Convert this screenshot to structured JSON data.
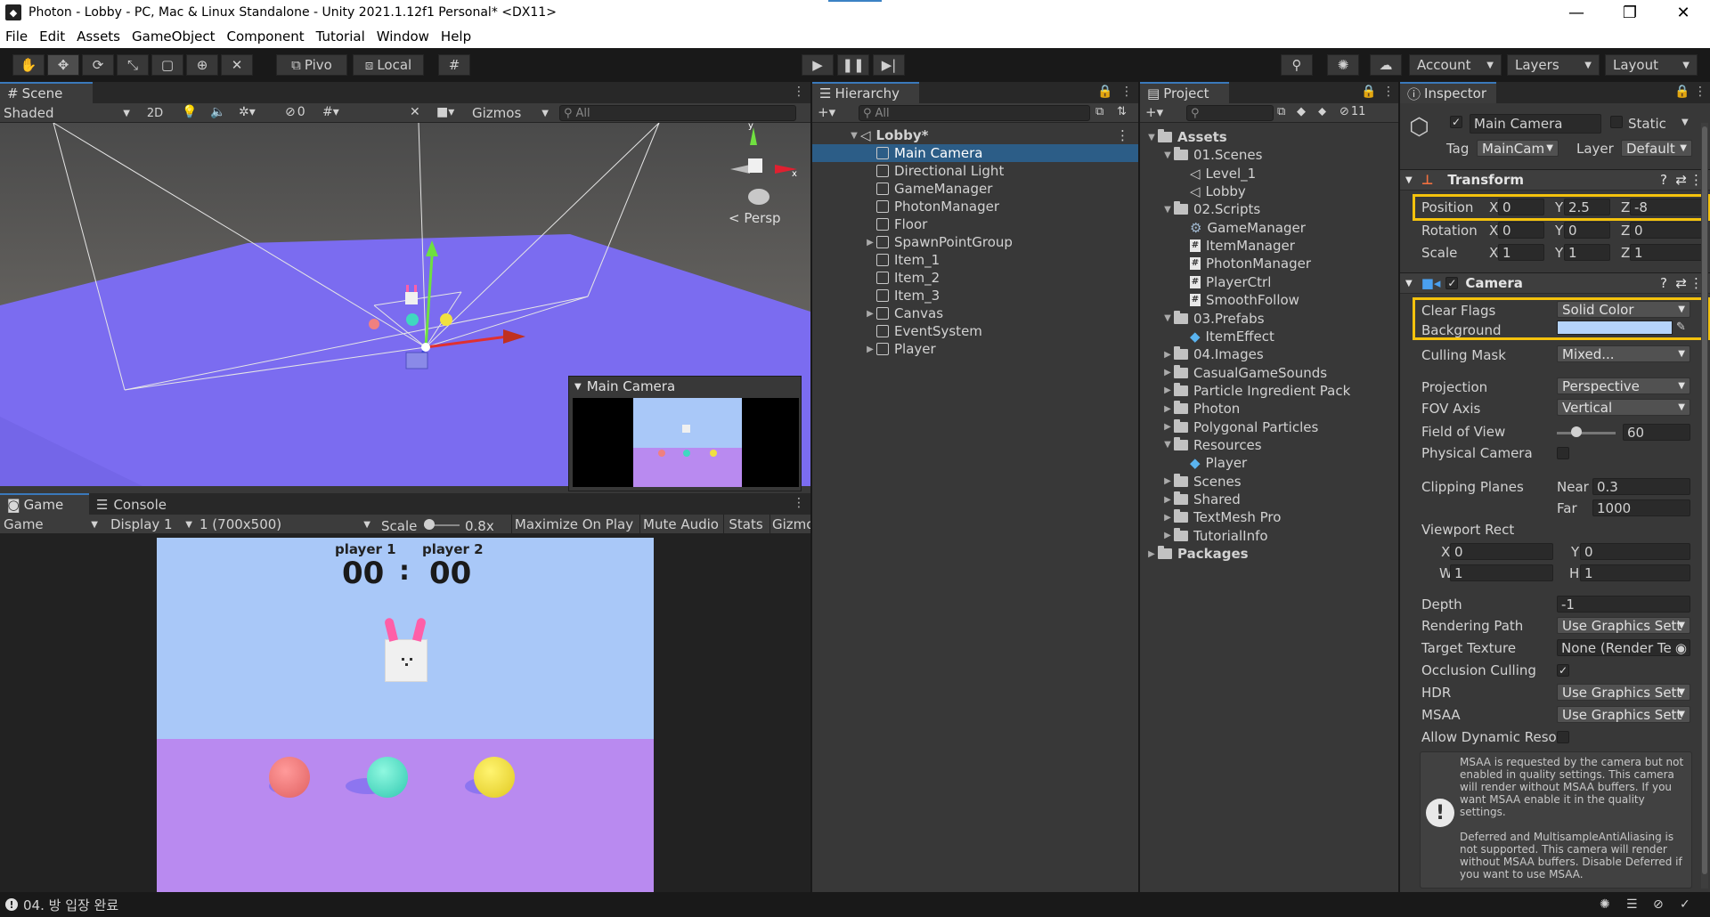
{
  "window": {
    "title": "Photon - Lobby - PC, Mac & Linux Standalone - Unity 2021.1.12f1 Personal* <DX11>",
    "minimize": "—",
    "maximize": "❐",
    "close": "✕"
  },
  "menu": [
    "File",
    "Edit",
    "Assets",
    "GameObject",
    "Component",
    "Tutorial",
    "Window",
    "Help"
  ],
  "toolbar": {
    "pivot": "Pivo",
    "local": "Local",
    "account": "Account",
    "layers": "Layers",
    "layout": "Layout"
  },
  "scene": {
    "tab": "Scene",
    "shading": "Shaded",
    "mode_2d": "2D",
    "hidden_count": "0",
    "gizmos": "Gizmos",
    "search_placeholder": "All",
    "persp": "< Persp",
    "cam_preview_title": "Main Camera"
  },
  "game": {
    "tab_game": "Game",
    "tab_console": "Console",
    "mode": "Game",
    "display": "Display 1",
    "resolution": "1 (700x500)",
    "scale_label": "Scale",
    "scale_value": "0.8x",
    "maximize": "Maximize On Play",
    "mute": "Mute Audio",
    "stats": "Stats",
    "gizmos": "Gizmo",
    "player1": "player 1",
    "player2": "player 2",
    "score1": "00",
    "colon": ":",
    "score2": "00"
  },
  "hierarchy": {
    "tab": "Hierarchy",
    "search_placeholder": "All",
    "root": "Lobby*",
    "items": [
      {
        "label": "Main Camera",
        "expand": false,
        "selected": true
      },
      {
        "label": "Directional Light",
        "expand": false
      },
      {
        "label": "GameManager",
        "expand": false
      },
      {
        "label": "PhotonManager",
        "expand": false
      },
      {
        "label": "Floor",
        "expand": false
      },
      {
        "label": "SpawnPointGroup",
        "expand": true
      },
      {
        "label": "Item_1",
        "expand": false
      },
      {
        "label": "Item_2",
        "expand": false
      },
      {
        "label": "Item_3",
        "expand": false
      },
      {
        "label": "Canvas",
        "expand": true
      },
      {
        "label": "EventSystem",
        "expand": false
      },
      {
        "label": "Player",
        "expand": true
      }
    ]
  },
  "project": {
    "tab": "Project",
    "badge": "11",
    "items": [
      {
        "label": "Assets",
        "depth": 0,
        "type": "folder",
        "arrow": "open",
        "bold": true
      },
      {
        "label": "01.Scenes",
        "depth": 1,
        "type": "folder",
        "arrow": "open"
      },
      {
        "label": "Level_1",
        "depth": 2,
        "type": "scene"
      },
      {
        "label": "Lobby",
        "depth": 2,
        "type": "scene"
      },
      {
        "label": "02.Scripts",
        "depth": 1,
        "type": "folder",
        "arrow": "open"
      },
      {
        "label": "GameManager",
        "depth": 2,
        "type": "gear"
      },
      {
        "label": "ItemManager",
        "depth": 2,
        "type": "script"
      },
      {
        "label": "PhotonManager",
        "depth": 2,
        "type": "script"
      },
      {
        "label": "PlayerCtrl",
        "depth": 2,
        "type": "script"
      },
      {
        "label": "SmoothFollow",
        "depth": 2,
        "type": "script"
      },
      {
        "label": "03.Prefabs",
        "depth": 1,
        "type": "folder",
        "arrow": "open"
      },
      {
        "label": "ItemEffect",
        "depth": 2,
        "type": "prefab"
      },
      {
        "label": "04.Images",
        "depth": 1,
        "type": "folder",
        "arrow": "closed"
      },
      {
        "label": "CasualGameSounds",
        "depth": 1,
        "type": "folder",
        "arrow": "closed"
      },
      {
        "label": "Particle Ingredient Pack",
        "depth": 1,
        "type": "folder",
        "arrow": "closed"
      },
      {
        "label": "Photon",
        "depth": 1,
        "type": "folder",
        "arrow": "closed"
      },
      {
        "label": "Polygonal Particles",
        "depth": 1,
        "type": "folder",
        "arrow": "closed"
      },
      {
        "label": "Resources",
        "depth": 1,
        "type": "folder",
        "arrow": "open"
      },
      {
        "label": "Player",
        "depth": 2,
        "type": "prefab"
      },
      {
        "label": "Scenes",
        "depth": 1,
        "type": "folder",
        "arrow": "closed"
      },
      {
        "label": "Shared",
        "depth": 1,
        "type": "folder",
        "arrow": "closed"
      },
      {
        "label": "TextMesh Pro",
        "depth": 1,
        "type": "folder",
        "arrow": "closed"
      },
      {
        "label": "TutorialInfo",
        "depth": 1,
        "type": "folder",
        "arrow": "closed"
      },
      {
        "label": "Packages",
        "depth": 0,
        "type": "folder",
        "arrow": "closed",
        "bold": true
      }
    ]
  },
  "inspector": {
    "tab": "Inspector",
    "object_name": "Main Camera",
    "static": "Static",
    "tag_label": "Tag",
    "tag_value": "MainCam",
    "layer_label": "Layer",
    "layer_value": "Default",
    "transform": {
      "title": "Transform",
      "position": {
        "label": "Position",
        "x": "0",
        "y": "2.5",
        "z": "-8"
      },
      "rotation": {
        "label": "Rotation",
        "x": "0",
        "y": "0",
        "z": "0"
      },
      "scale": {
        "label": "Scale",
        "x": "1",
        "y": "1",
        "z": "1"
      }
    },
    "camera": {
      "title": "Camera",
      "clear_flags_label": "Clear Flags",
      "clear_flags": "Solid Color",
      "background_label": "Background",
      "background_color": "#b5d3fa",
      "culling_mask_label": "Culling Mask",
      "culling_mask": "Mixed...",
      "projection_label": "Projection",
      "projection": "Perspective",
      "fov_axis_label": "FOV Axis",
      "fov_axis": "Vertical",
      "fov_label": "Field of View",
      "fov": "60",
      "fov_slider_fraction": 0.33,
      "physical_label": "Physical Camera",
      "clipping_label": "Clipping Planes",
      "near_label": "Near",
      "near": "0.3",
      "far_label": "Far",
      "far": "1000",
      "viewport_label": "Viewport Rect",
      "vx": "0",
      "vy": "0",
      "vw": "1",
      "vh": "1",
      "depth_label": "Depth",
      "depth": "-1",
      "rendering_path_label": "Rendering Path",
      "rendering_path": "Use Graphics Sett",
      "target_texture_label": "Target Texture",
      "target_texture": "None (Render Te",
      "occlusion_label": "Occlusion Culling",
      "hdr_label": "HDR",
      "hdr": "Use Graphics Sett",
      "msaa_label": "MSAA",
      "msaa": "Use Graphics Sett",
      "dynamic_label": "Allow Dynamic Reso",
      "help1": "MSAA is requested by the camera but not enabled in quality settings. This camera will render without MSAA buffers. If you want MSAA enable it in the quality settings.",
      "help2": "Deferred and MultisampleAntiAliasing is not supported. This camera will render without MSAA buffers. Disable Deferred if you want to use MSAA."
    }
  },
  "status": {
    "message": "04. 방 입장 완료"
  },
  "colors": {
    "accent": "#3a79bb",
    "highlight": "#f4c20d",
    "selection": "#2c5d87",
    "floor": "#7b6cf0",
    "sky": "#a9c8f8",
    "game_floor": "#b98af0"
  }
}
